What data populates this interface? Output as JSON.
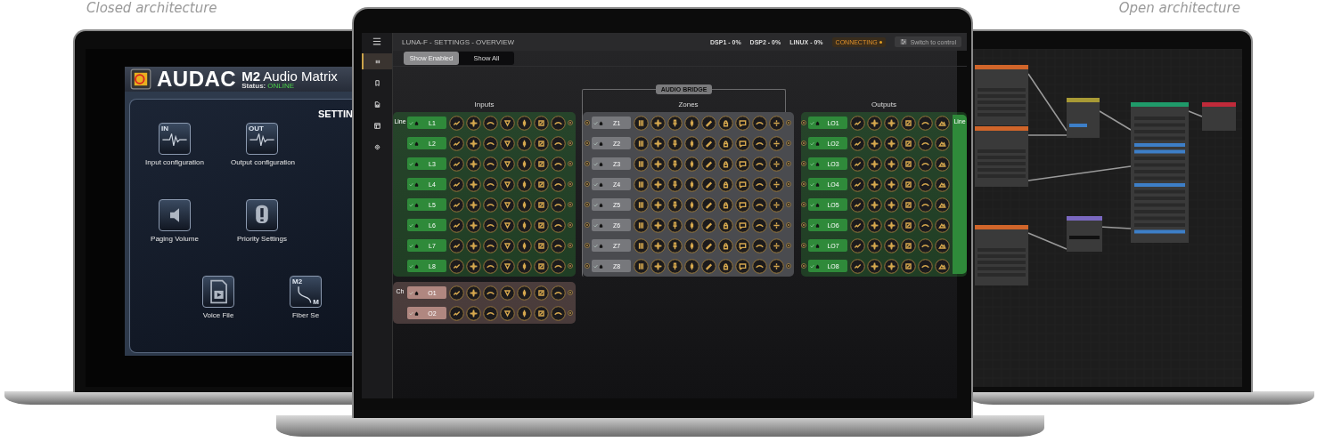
{
  "captions": {
    "left": "Closed architecture",
    "right": "Open architecture"
  },
  "left_screen": {
    "brand": "AUDAC",
    "product": "**M2** Audio Matrix",
    "status_label": "Status:",
    "status_value": "ONLINE",
    "section_title": "SETTIN",
    "tiles": [
      {
        "kind": "in",
        "icon_labels": [
          "IN"
        ],
        "label": "Input configuration"
      },
      {
        "kind": "out",
        "icon_labels": [
          "OUT"
        ],
        "label": "Output configuration"
      },
      {
        "kind": "speaker",
        "label": "Paging Volume"
      },
      {
        "kind": "priority",
        "label": "Priority Settings"
      },
      {
        "kind": "voice",
        "label": "Voice File"
      },
      {
        "kind": "fiber",
        "icon_labels": [
          "M2",
          "M"
        ],
        "label": "Fiber Se"
      }
    ]
  },
  "center_screen": {
    "title": "LUNA-F - SETTINGS - OVERVIEW",
    "stats": [
      "DSP1 - 0%",
      "DSP2 - 0%",
      "LINUX - 0%"
    ],
    "connection": "CONNECTING",
    "control_button": {
      "label": "Switch to control",
      "disabled": true
    },
    "sidebar": {
      "items": [
        {
          "kind": "grid",
          "selected": true
        },
        {
          "kind": "bookmark",
          "selected": false
        },
        {
          "kind": "file",
          "selected": false
        },
        {
          "kind": "window",
          "selected": false
        },
        {
          "kind": "gear",
          "selected": false
        }
      ]
    },
    "view_toggle": [
      {
        "label": "Show Enabled",
        "selected": true
      },
      {
        "label": "Show All",
        "selected": false
      }
    ],
    "bridge_label": "AUDIO BRIDGE",
    "inputs": {
      "title": "Inputs",
      "groups": [
        {
          "label": "Line",
          "color": "#2f8a3a",
          "channels": [
            "L1",
            "L2",
            "L3",
            "L4",
            "L5",
            "L6",
            "L7",
            "L8"
          ]
        },
        {
          "label": "Ch",
          "color": "#b08780",
          "channels": [
            "O1",
            "O2"
          ]
        }
      ]
    },
    "zones": {
      "title": "Zones",
      "channels": [
        "Z1",
        "Z2",
        "Z3",
        "Z4",
        "Z5",
        "Z6",
        "Z7",
        "Z8"
      ]
    },
    "outputs": {
      "title": "Outputs",
      "groups": [
        {
          "label": "Line",
          "color": "#2f8a3a",
          "channels": [
            "LO1",
            "LO2",
            "LO3",
            "LO4",
            "LO5",
            "LO6",
            "LO7",
            "LO8"
          ]
        }
      ]
    }
  }
}
